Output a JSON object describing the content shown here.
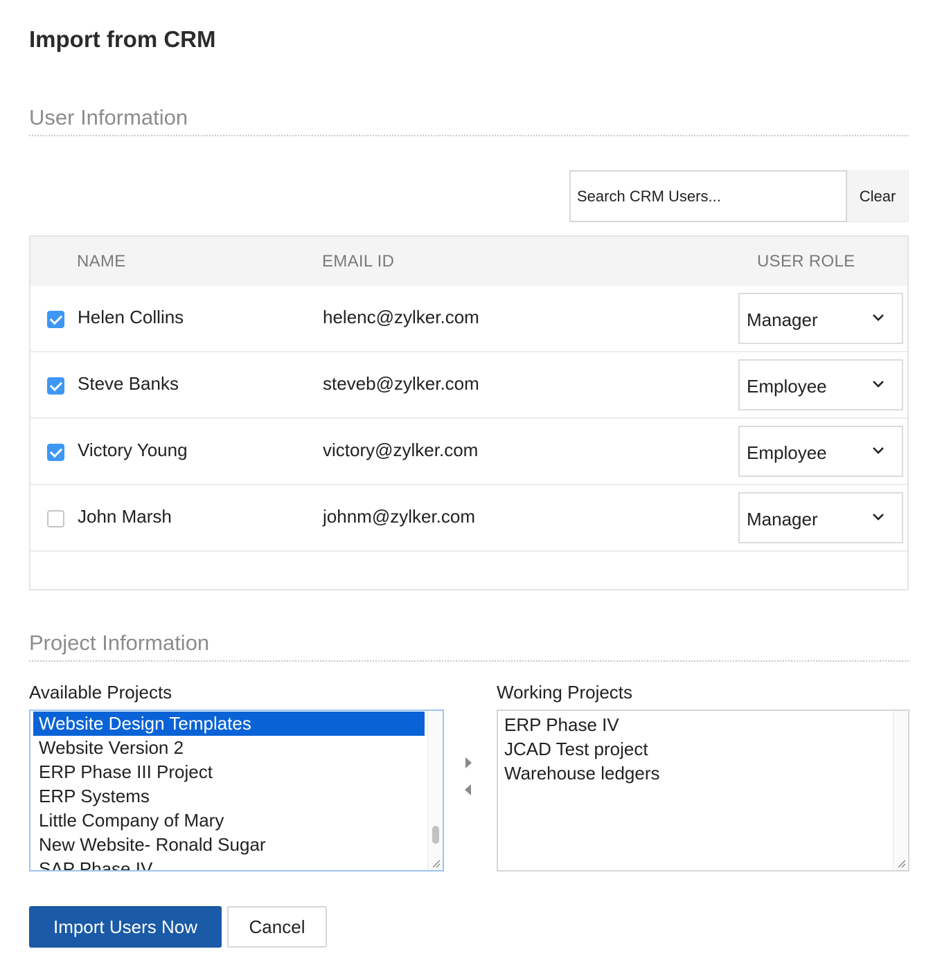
{
  "page": {
    "title": "Import from CRM"
  },
  "user_section": {
    "title": "User Information",
    "search": {
      "placeholder": "Search CRM Users...",
      "value": ""
    },
    "clear_label": "Clear",
    "columns": {
      "name": "NAME",
      "email": "EMAIL ID",
      "role": "USER ROLE"
    },
    "rows": [
      {
        "checked": true,
        "name": "Helen Collins",
        "email": "helenc@zylker.com",
        "role": "Manager"
      },
      {
        "checked": true,
        "name": "Steve Banks",
        "email": "steveb@zylker.com",
        "role": "Employee"
      },
      {
        "checked": true,
        "name": "Victory Young",
        "email": "victory@zylker.com",
        "role": "Employee"
      },
      {
        "checked": false,
        "name": "John Marsh",
        "email": "johnm@zylker.com",
        "role": "Manager"
      }
    ],
    "icons": {
      "role_dropdown": "chevron-down-icon",
      "checkbox": "check-icon"
    }
  },
  "project_section": {
    "title": "Project Information",
    "available": {
      "label": "Available Projects",
      "items": [
        "Website Design Templates",
        "Website Version 2",
        "ERP Phase III Project",
        "ERP Systems",
        "Little Company of Mary",
        "New Website- Ronald Sugar",
        "SAP Phase IV"
      ],
      "selected_index": 0
    },
    "working": {
      "label": "Working Projects",
      "items": [
        "ERP Phase IV",
        "JCAD Test project",
        "Warehouse ledgers"
      ]
    },
    "icons": {
      "move_right": "caret-right-icon",
      "move_left": "caret-left-icon"
    }
  },
  "actions": {
    "import_label": "Import Users Now",
    "cancel_label": "Cancel"
  },
  "colors": {
    "primary_button": "#1a5aa6",
    "checkbox_checked": "#3d97f4",
    "list_selection": "#0a63d6",
    "section_title": "#8c8c8c"
  }
}
